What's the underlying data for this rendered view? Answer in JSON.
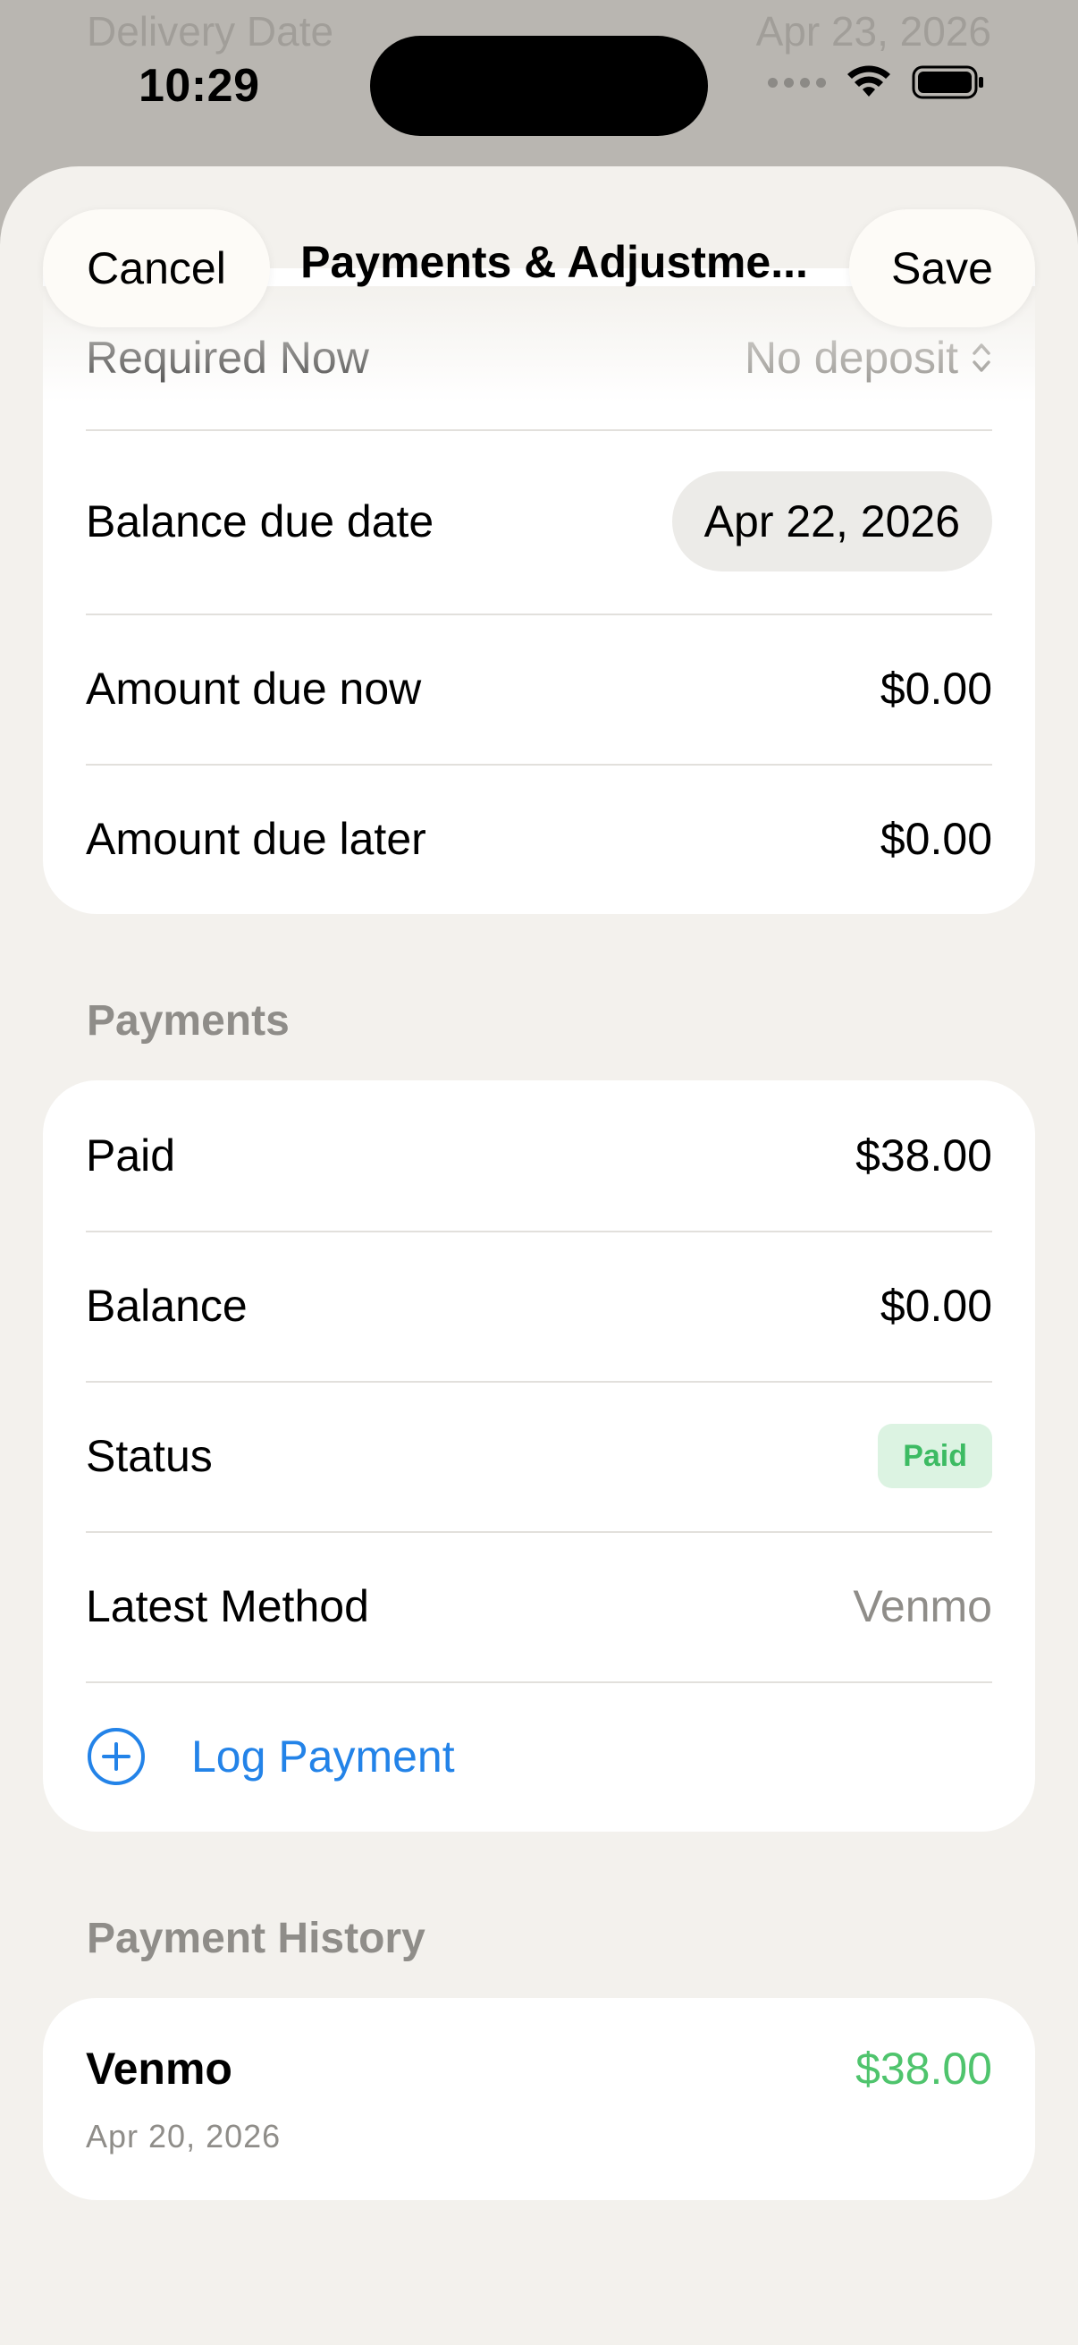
{
  "background": {
    "label": "Delivery Date",
    "value": "Apr 23, 2026"
  },
  "status_bar": {
    "time": "10:29"
  },
  "nav": {
    "cancel": "Cancel",
    "title": "Payments & Adjustme...",
    "save": "Save"
  },
  "deposit": {
    "required_label": "Required Now",
    "required_value": "No deposit",
    "balance_due_label": "Balance due date",
    "balance_due_value": "Apr 22, 2026",
    "due_now_label": "Amount due now",
    "due_now_value": "$0.00",
    "due_later_label": "Amount due later",
    "due_later_value": "$0.00"
  },
  "payments": {
    "header": "Payments",
    "paid_label": "Paid",
    "paid_value": "$38.00",
    "balance_label": "Balance",
    "balance_value": "$0.00",
    "status_label": "Status",
    "status_value": "Paid",
    "method_label": "Latest Method",
    "method_value": "Venmo",
    "log_payment": "Log Payment"
  },
  "history": {
    "header": "Payment History",
    "items": [
      {
        "method": "Venmo",
        "amount": "$38.00",
        "date": "Apr 20, 2026"
      }
    ]
  },
  "colors": {
    "accent_blue": "#2383e8",
    "paid_green": "#4fc46d",
    "badge_bg": "#dcf3e2"
  }
}
